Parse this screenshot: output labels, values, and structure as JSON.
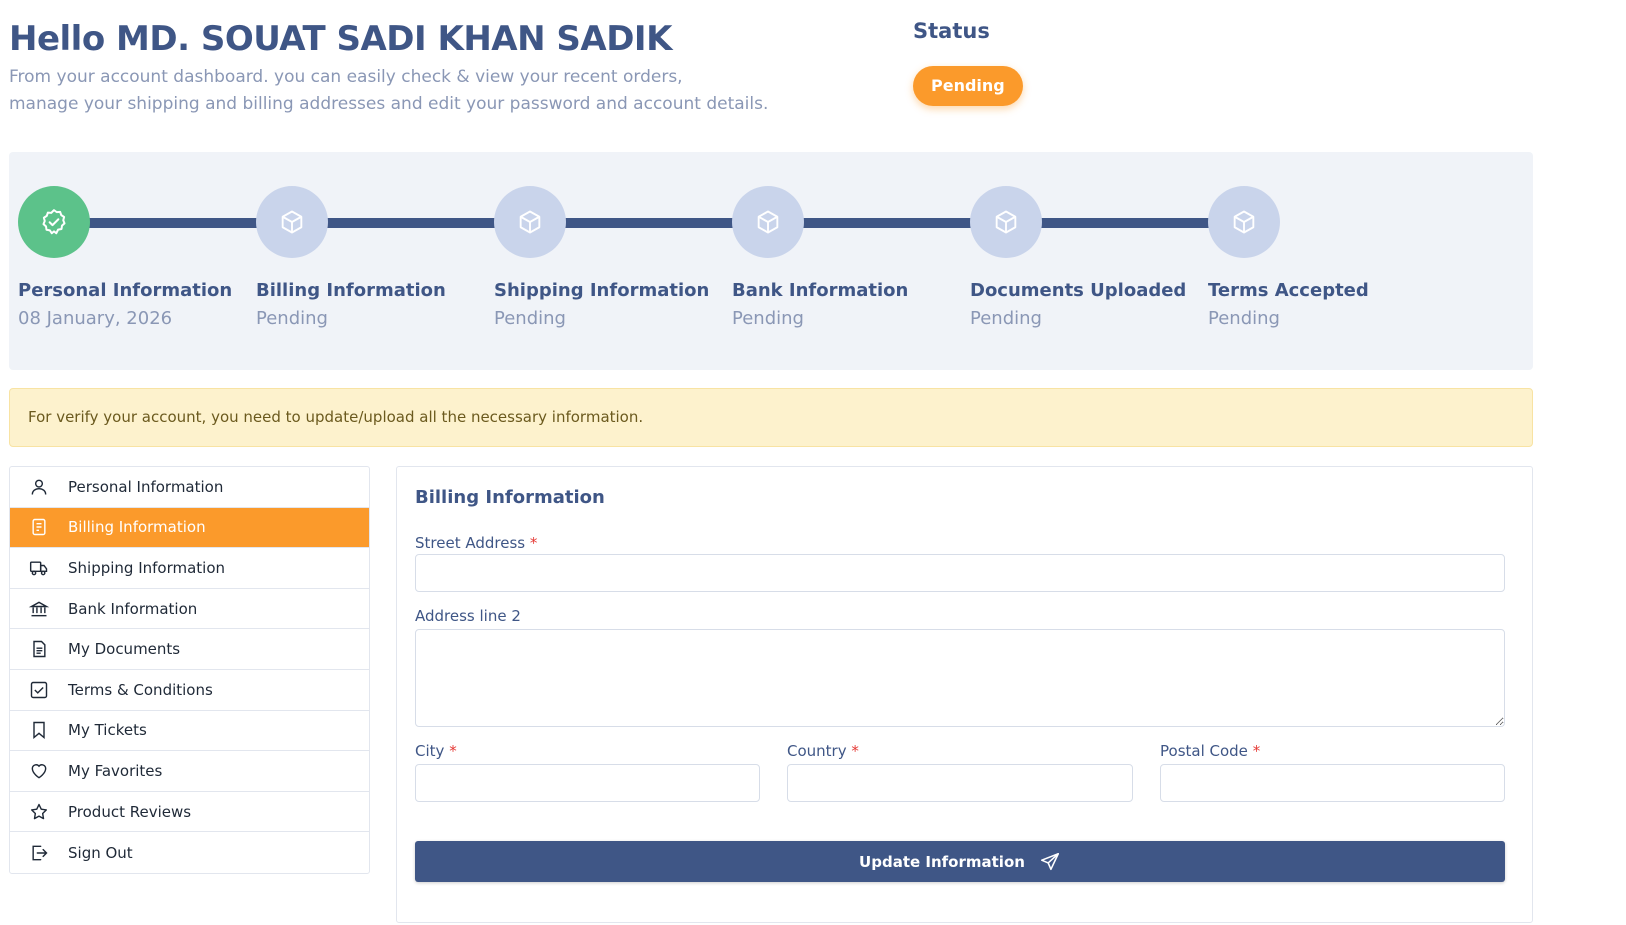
{
  "header": {
    "greeting": "Hello MD. SOUAT SADI KHAN SADIK",
    "description_line1": "From your account dashboard. you can easily check & view your recent orders,",
    "description_line2": "manage your shipping and billing addresses and edit your password and account details."
  },
  "status": {
    "title": "Status",
    "badge": "Pending",
    "badge_color": "#fb9a2b"
  },
  "steps": [
    {
      "title": "Personal Information",
      "subtitle": "08 January, 2026",
      "done": true,
      "icon": "check-badge-icon"
    },
    {
      "title": "Billing Information",
      "subtitle": "Pending",
      "done": false,
      "icon": "box-icon"
    },
    {
      "title": "Shipping Information",
      "subtitle": "Pending",
      "done": false,
      "icon": "box-icon"
    },
    {
      "title": "Bank Information",
      "subtitle": "Pending",
      "done": false,
      "icon": "box-icon"
    },
    {
      "title": "Documents Uploaded",
      "subtitle": "Pending",
      "done": false,
      "icon": "box-icon"
    },
    {
      "title": "Terms Accepted",
      "subtitle": "Pending",
      "done": false,
      "icon": "box-icon"
    }
  ],
  "alert": {
    "text": "For verify your account, you need to update/upload all the necessary information."
  },
  "menu": {
    "items": [
      {
        "label": "Personal Information",
        "icon": "user-icon"
      },
      {
        "label": "Billing Information",
        "icon": "receipt-icon",
        "active": true
      },
      {
        "label": "Shipping Information",
        "icon": "truck-icon"
      },
      {
        "label": "Bank Information",
        "icon": "bank-icon"
      },
      {
        "label": "My Documents",
        "icon": "document-icon"
      },
      {
        "label": "Terms & Conditions",
        "icon": "checkbox-icon"
      },
      {
        "label": "My Tickets",
        "icon": "bookmark-icon"
      },
      {
        "label": "My Favorites",
        "icon": "heart-icon"
      },
      {
        "label": "Product Reviews",
        "icon": "star-icon"
      },
      {
        "label": "Sign Out",
        "icon": "sign-out-icon"
      }
    ]
  },
  "form": {
    "title": "Billing Information",
    "street_label": "Street Address",
    "street_value": "",
    "address2_label": "Address line 2",
    "address2_value": "",
    "city_label": "City",
    "city_value": "",
    "country_label": "Country",
    "country_value": "",
    "postal_label": "Postal Code",
    "postal_value": "",
    "required_mark": "*",
    "submit_label": "Update Information"
  },
  "colors": {
    "primary": "#3f5686",
    "accent": "#fb9a2b",
    "success": "#5cc28a",
    "pending_step": "#c9d4eb"
  }
}
